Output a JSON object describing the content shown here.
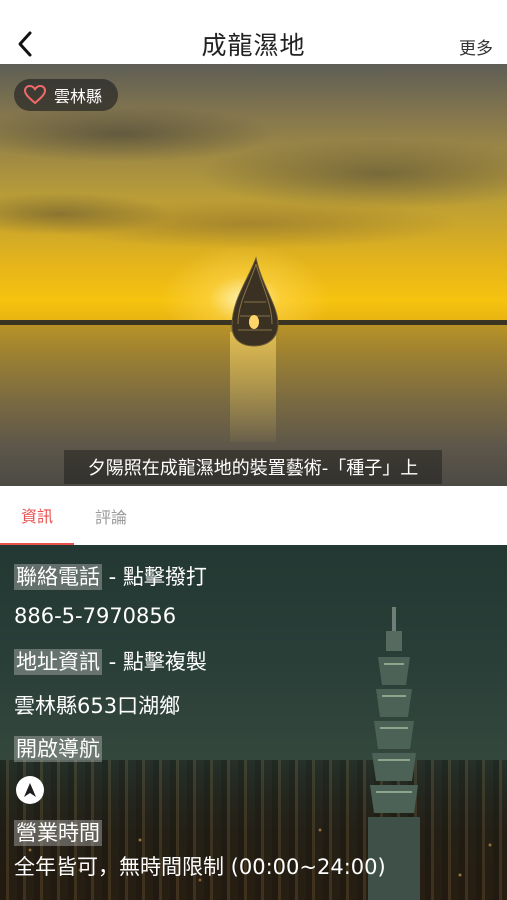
{
  "header": {
    "title": "成龍濕地",
    "more_label": "更多"
  },
  "hero": {
    "tag_label": "雲林縣",
    "caption": "夕陽照在成龍濕地的裝置藝術-「種子」上"
  },
  "tabs": [
    {
      "label": "資訊",
      "active": true
    },
    {
      "label": "評論",
      "active": false
    }
  ],
  "info": {
    "phone_label": "聯絡電話",
    "phone_action": " - 點擊撥打",
    "phone_value": "886-5-7970856",
    "address_label": "地址資訊",
    "address_action": " - 點擊複製",
    "address_value": "雲林縣653口湖鄉",
    "nav_label": "開啟導航",
    "hours_label": "營業時間",
    "hours_value": "全年皆可，無時間限制 (00:00~24:00)"
  },
  "colors": {
    "accent": "#e8504d",
    "tab_inactive": "#9a9a9a"
  },
  "icons": [
    "back-chevron-icon",
    "heart-outline-icon",
    "navigation-arrow-icon"
  ]
}
